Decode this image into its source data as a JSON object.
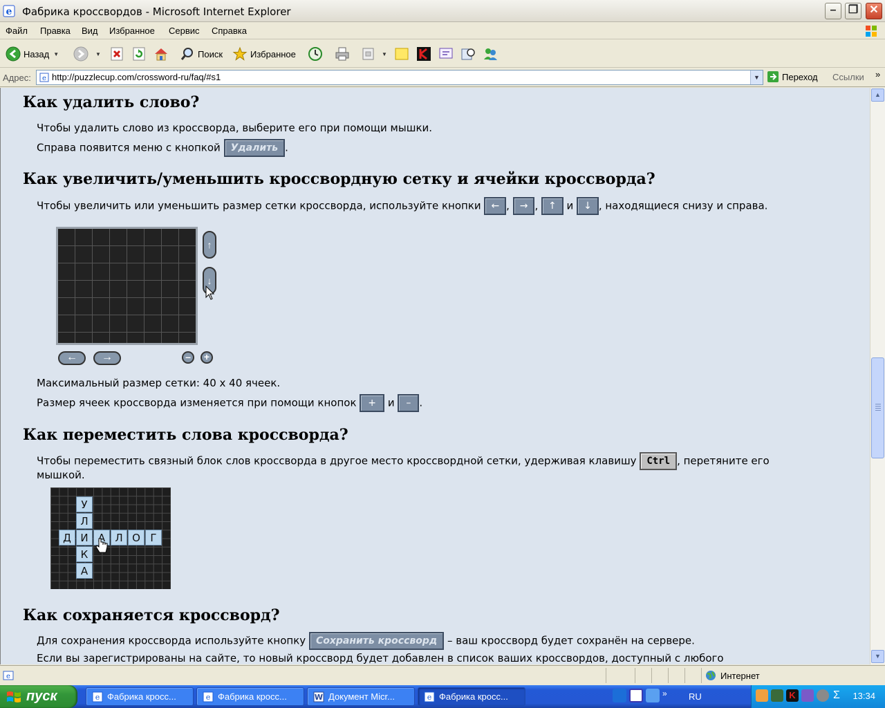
{
  "window": {
    "title": "Фабрика кроссвордов - Microsoft Internet Explorer",
    "minimize": "–",
    "maximize": "❐",
    "close": "✕"
  },
  "menu": [
    "Файл",
    "Правка",
    "Вид",
    "Избранное",
    "Сервис",
    "Справка"
  ],
  "toolbar": {
    "back_label": "Назад",
    "search_label": "Поиск",
    "favorites_label": "Избранное"
  },
  "address": {
    "label": "Адрес:",
    "url": "http://puzzlecup.com/crossword-ru/faq/#s1",
    "go_label": "Переход",
    "links_label": "Ссылки",
    "chevron": "»"
  },
  "content": {
    "s1": {
      "heading": "Как удалить слово?",
      "line1": "Чтобы удалить слово из кроссворда, выберите его при помощи мышки.",
      "line2_before": "Справа появится меню с кнопкой",
      "delete_button": "Удалить",
      "line2_after": "."
    },
    "s2": {
      "heading": "Как увеличить/уменьшить кроссвордную сетку и ячейки кроссворда?",
      "line1_before": "Чтобы увеличить или уменьшить размер сетки кроссворда, используйте кнопки",
      "btn_left": "←",
      "comma1": ",",
      "btn_right": "→",
      "comma2": ",",
      "btn_up": "↑",
      "and1": "и",
      "btn_down": "↓",
      "line1_after": ", находящиеся снизу и справа.",
      "fig_up": "↑",
      "fig_down": "↓",
      "fig_left": "←",
      "fig_right": "→",
      "fig_minus": "–",
      "fig_plus": "+",
      "max_size": "Максимальный размер сетки: 40 x 40 ячеек.",
      "cell_before": "Размер ячеек кроссворда изменяется при помощи кнопок",
      "btn_plus": "+",
      "and2": "и",
      "btn_minus": "–",
      "cell_after": "."
    },
    "s3": {
      "heading": "Как переместить слова кроссворда?",
      "line1_before": "Чтобы переместить связный блок слов кроссворда в другое место кроссвордной сетки, удерживая клавишу",
      "ctrl_key": "Ctrl",
      "line1_after": ", перетяните его",
      "line2": "мышкой.",
      "vertical_word": [
        "У",
        "Л",
        "И",
        "К",
        "А"
      ],
      "horizontal_word": [
        "Д",
        "И",
        "А",
        "Л",
        "О",
        "Г"
      ]
    },
    "s4": {
      "heading": "Как сохраняется кроссворд?",
      "line1_before": "Для сохранения кроссворда используйте кнопку",
      "save_button": "Сохранить кроссворд",
      "line1_after": "– ваш кроссворд будет сохранён на сервере.",
      "line2": "Если вы зарегистрированы на сайте, то новый кроссворд будет добавлен в список ваших кроссвордов, доступный с любого"
    }
  },
  "status": {
    "zone": "Интернет"
  },
  "taskbar": {
    "start_label": "пуск",
    "tasks": [
      "Фабрика кросс...",
      "Фабрика кросс...",
      "Документ Micr...",
      "Фабрика кросс..."
    ],
    "lang": "RU",
    "clock": "13:34"
  },
  "colors": {
    "content_bg": "#dce4ee",
    "button_bg": "#7d8ea4",
    "taskbar_blue": "#2458d4",
    "start_green": "#33963a"
  }
}
